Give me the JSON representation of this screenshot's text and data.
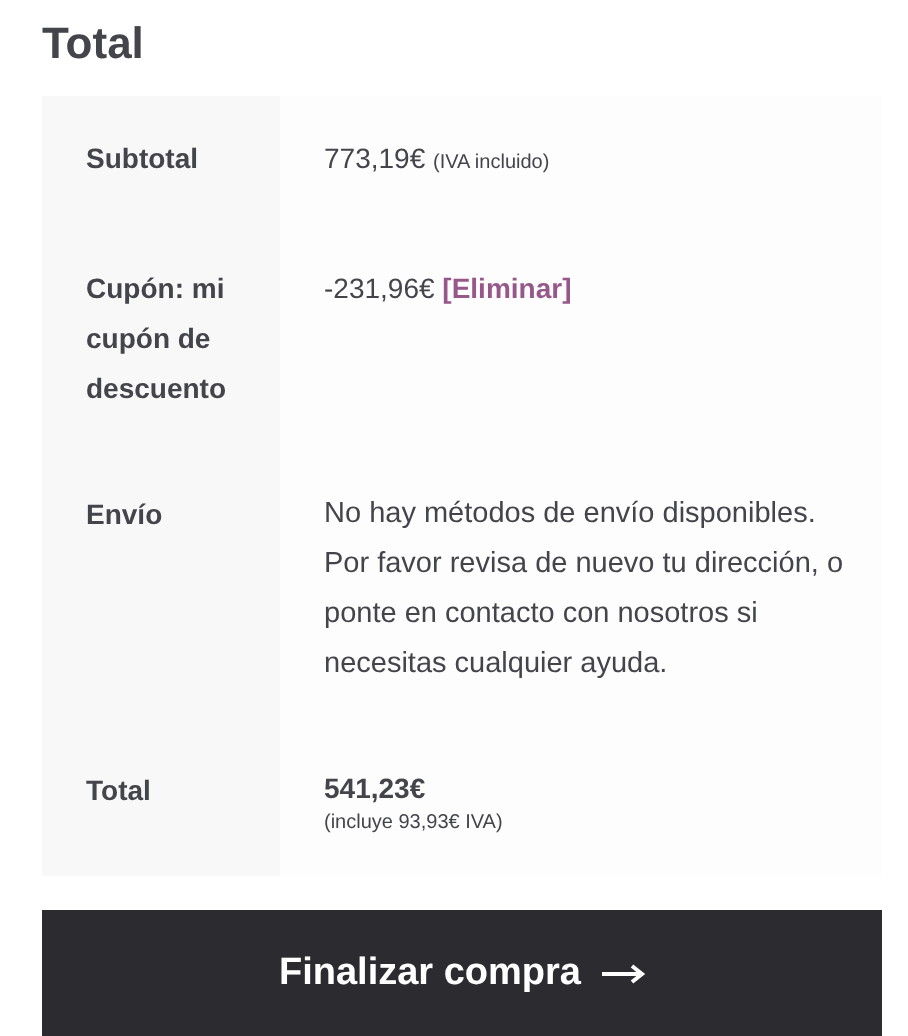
{
  "heading": "Total",
  "rows": [
    {
      "kind": "amount_note",
      "label": "Subtotal",
      "amount": "773,19€",
      "note": "(IVA incluido)"
    },
    {
      "kind": "coupon",
      "label": "Cupón: mi cupón de descuento",
      "amount": "-231,96€",
      "link": "[Eliminar]"
    },
    {
      "kind": "message",
      "label": "Envío",
      "text": "No hay métodos de envío disponibles. Por favor revisa de nuevo tu dirección, o ponte en contacto con nosotros si necesitas cualquier ayuda."
    },
    {
      "kind": "total",
      "label": "Total",
      "amount": "541,23€",
      "note": "(incluye 93,93€ IVA)"
    }
  ],
  "checkout_button": {
    "label": "Finalizar compra"
  }
}
